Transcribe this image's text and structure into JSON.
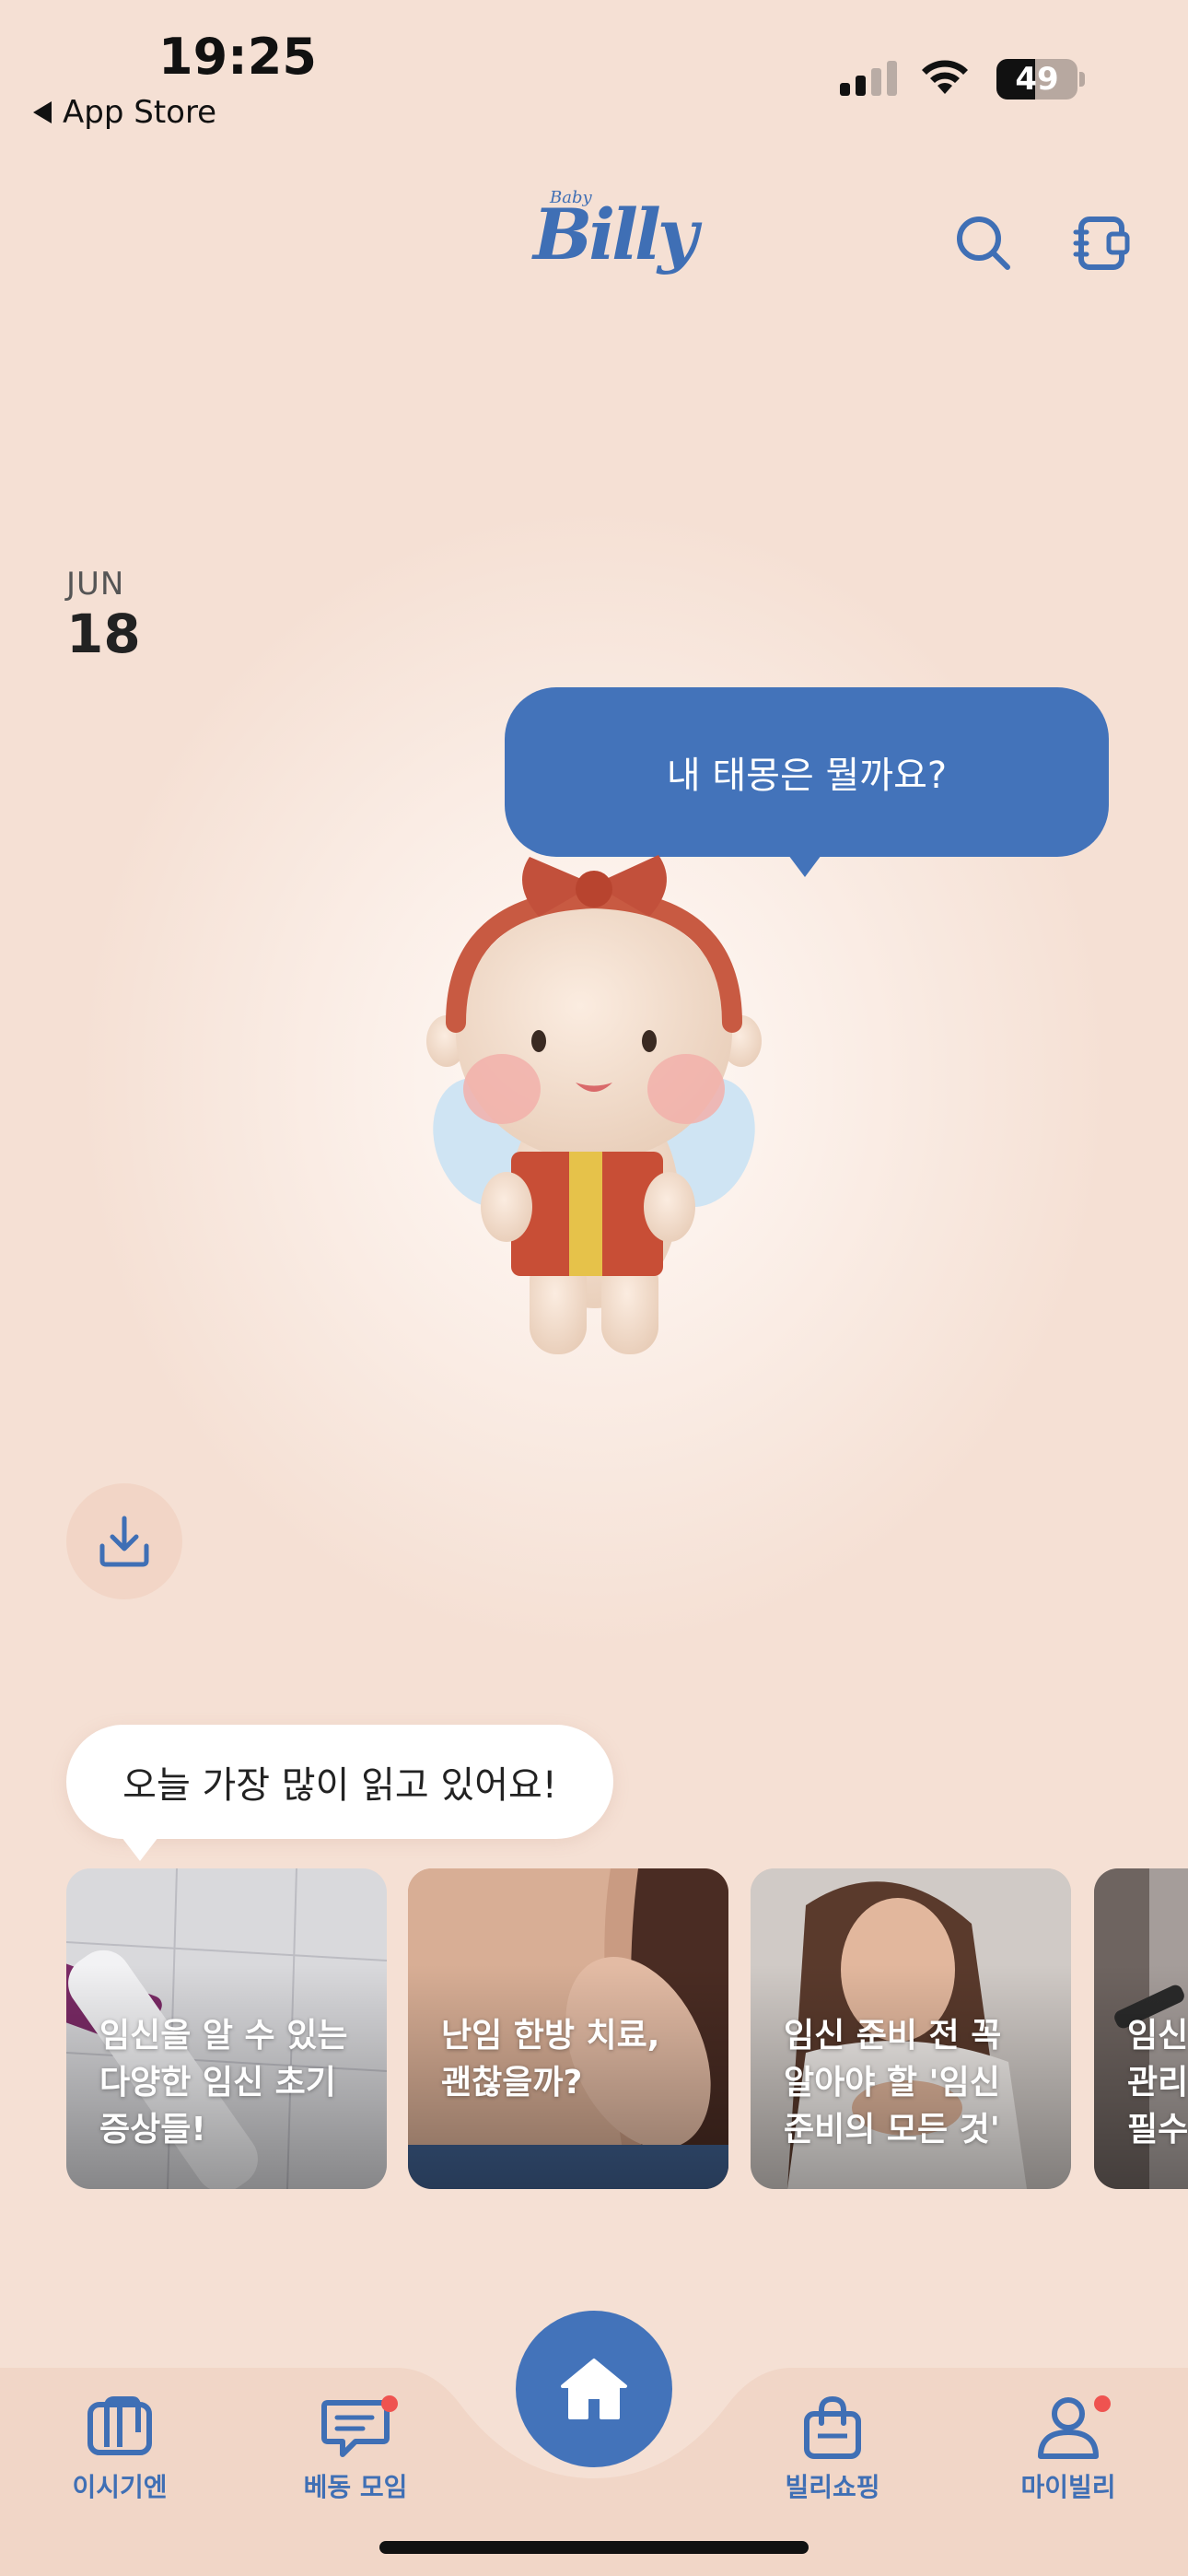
{
  "status_bar": {
    "time": "19:25",
    "back_label": "App Store",
    "battery": "49"
  },
  "header": {
    "logo_small": "Baby",
    "logo_big": "Billy"
  },
  "date": {
    "month": "JUN",
    "day": "18"
  },
  "bubble": {
    "text": "내 태몽은 뭘까요?"
  },
  "popular": {
    "tooltip": "오늘 가장 많이 읽고 있어요!",
    "cards": [
      {
        "title": "임신을 알 수 있는\n다양한 임신 초기\n증상들!"
      },
      {
        "title": "난임 한방 치료,\n괜찮을까?"
      },
      {
        "title": "임신 준비 전 꼭\n알아야 할 '임신\n준비의 모든 것'"
      },
      {
        "title": "임신\n관리\n필수"
      }
    ]
  },
  "tabbar": {
    "items": [
      {
        "label": "이시기엔",
        "icon": "book-icon",
        "badge": false
      },
      {
        "label": "베동 모임",
        "icon": "chat-icon",
        "badge": true
      },
      {
        "label": "홈",
        "icon": "home-icon",
        "badge": false
      },
      {
        "label": "빌리쇼핑",
        "icon": "shopping-bag-icon",
        "badge": false
      },
      {
        "label": "마이빌리",
        "icon": "person-icon",
        "badge": true
      }
    ]
  },
  "colors": {
    "brand": "#4373ba",
    "background": "#f5e0d4",
    "badge": "#ef5350"
  }
}
